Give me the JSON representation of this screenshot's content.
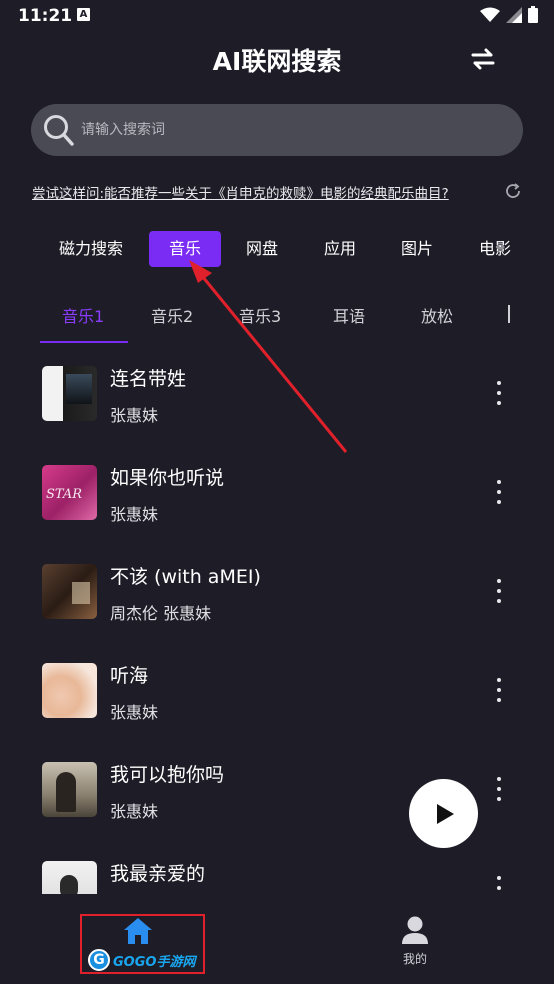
{
  "status_bar": {
    "time": "11:21",
    "notification_icon_letter": "A"
  },
  "header": {
    "title": "AI联网搜索"
  },
  "search": {
    "placeholder": "请输入搜索词",
    "value": ""
  },
  "suggestion": {
    "text": "尝试这样问:能否推荐一些关于《肖申克的救赎》电影的经典配乐曲目?"
  },
  "categories": [
    "磁力搜索",
    "音乐",
    "网盘",
    "应用",
    "图片",
    "电影"
  ],
  "active_category": "音乐",
  "subtabs": [
    "音乐1",
    "音乐2",
    "音乐3",
    "耳语",
    "放松"
  ],
  "active_subtab": "音乐1",
  "songs": [
    {
      "title": "连名带姓",
      "artist": "张惠妹"
    },
    {
      "title": "如果你也听说",
      "artist": "张惠妹"
    },
    {
      "title": "不该 (with aMEI)",
      "artist": "周杰伦 张惠妹"
    },
    {
      "title": "听海",
      "artist": "张惠妹"
    },
    {
      "title": "我可以抱你吗",
      "artist": "张惠妹"
    },
    {
      "title": "我最亲爱的",
      "artist": ""
    }
  ],
  "bottom_nav": {
    "home_watermark": "GOGO手游网",
    "mine_label": "我的"
  },
  "colors": {
    "background": "#1e1d27",
    "accent": "#7a2cf5",
    "annotation_red": "#e0212b"
  }
}
